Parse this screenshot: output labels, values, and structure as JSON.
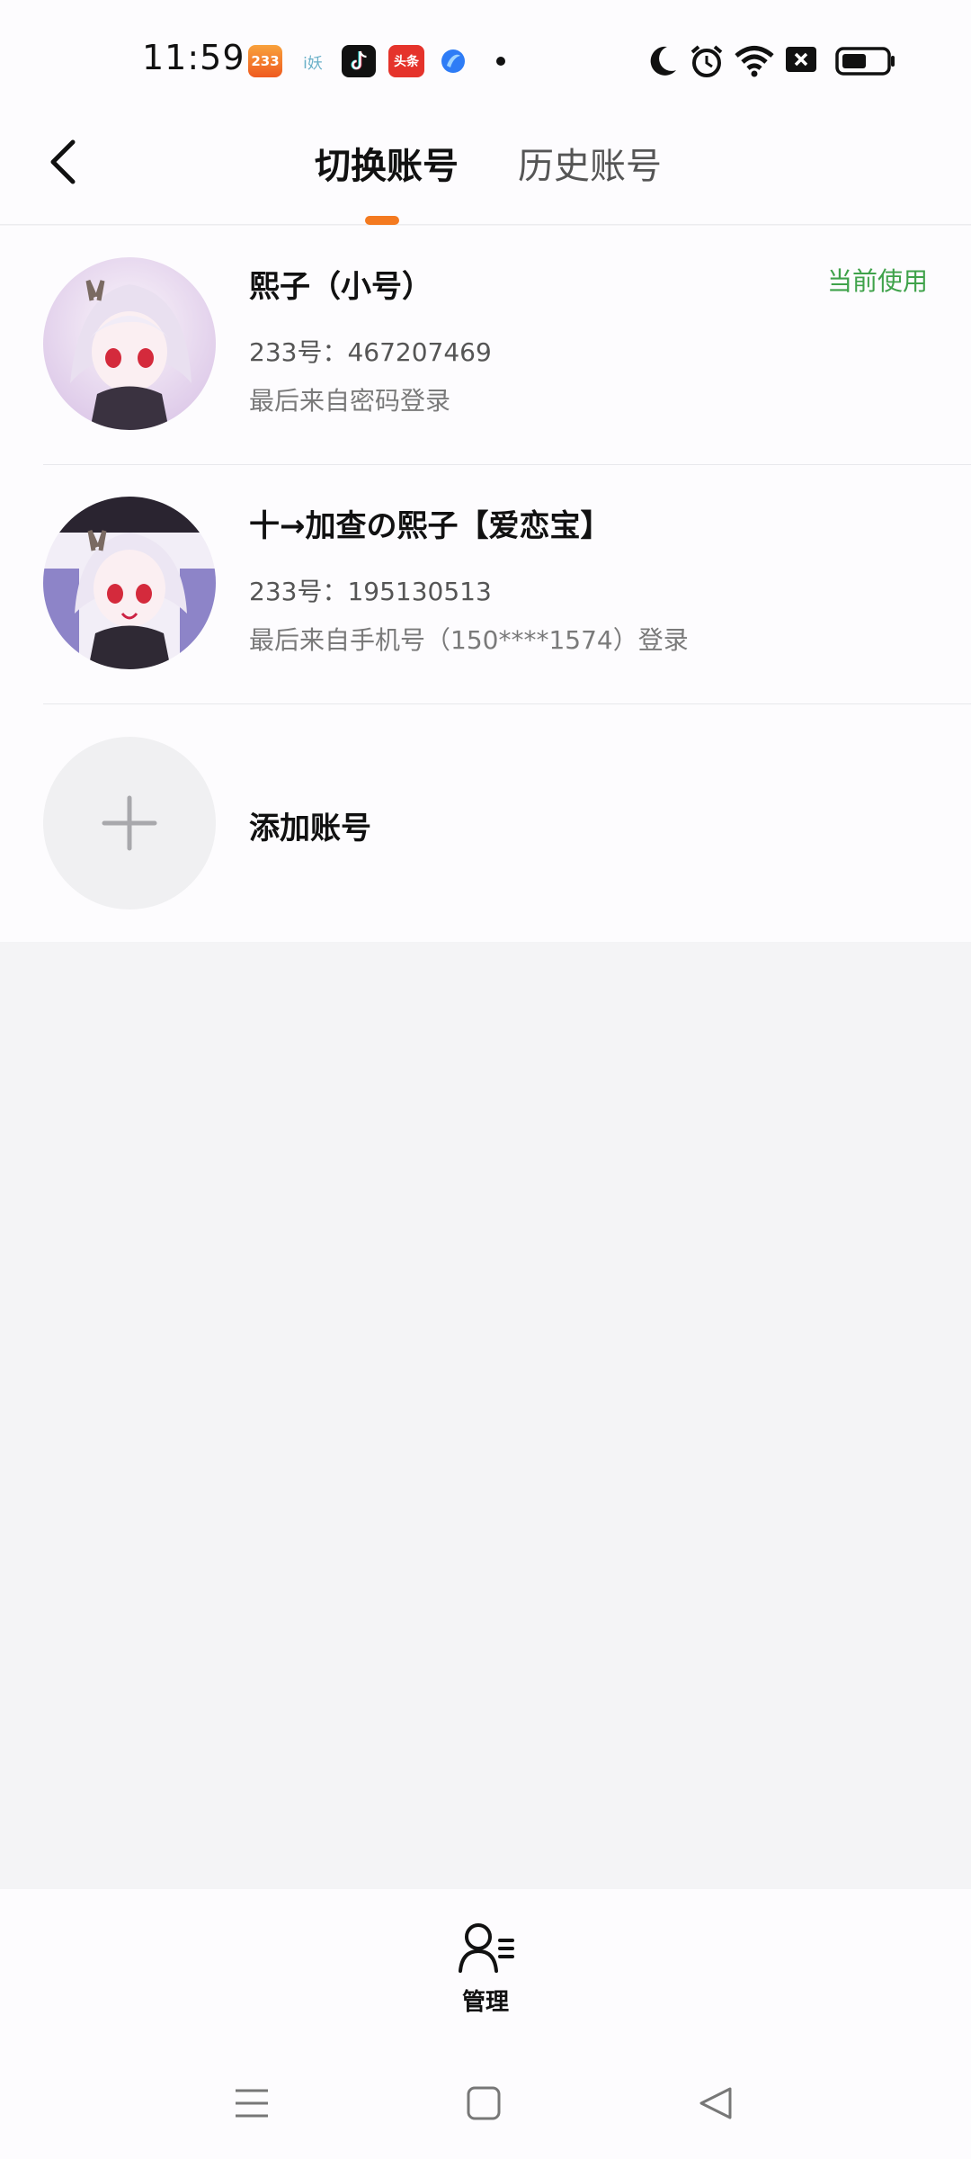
{
  "status_bar": {
    "time": "11:59",
    "notif_233_text": "233",
    "notif_toutiao_text": "头条",
    "notif_small_text": "i妖"
  },
  "header": {
    "tabs": [
      {
        "label": "切换账号",
        "active": true
      },
      {
        "label": "历史账号",
        "active": false
      }
    ]
  },
  "accounts": [
    {
      "name": "熙子（小号）",
      "id_line": "233号：467207469",
      "login_line": "最后来自密码登录",
      "badge": "当前使用"
    },
    {
      "name": "十→加查の熙子【爱恋宝】",
      "id_line": "233号：195130513",
      "login_line": "最后来自手机号（150****1574）登录",
      "badge": ""
    }
  ],
  "add_account": {
    "label": "添加账号"
  },
  "bottom": {
    "manage_label": "管理"
  },
  "colors": {
    "accent": "#f47a20",
    "current_badge": "#3fa24a",
    "background": "#f4f4f6"
  }
}
